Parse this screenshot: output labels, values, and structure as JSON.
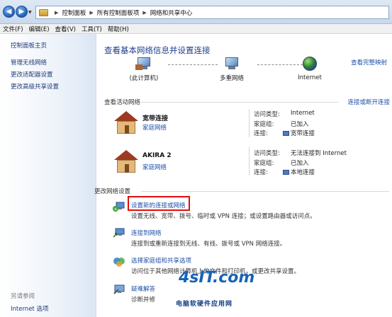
{
  "address_bar": {
    "breadcrumbs": [
      "控制面板",
      "所有控制面板项",
      "网络和共享中心"
    ]
  },
  "menu": [
    "文件(F)",
    "编辑(E)",
    "查看(V)",
    "工具(T)",
    "帮助(H)"
  ],
  "sidebar": {
    "items": [
      "控制面板主页",
      "管理无线网络",
      "更改适配器设置",
      "更改高级共享设置"
    ],
    "see_also": "另请参阅",
    "see_also_items": [
      "Internet 选项"
    ]
  },
  "main": {
    "title": "查看基本网络信息并设置连接",
    "full_map_link": "查看完整映射",
    "map": {
      "this_pc": "(此计算机)",
      "multiple_networks": "多重网络",
      "internet": "Internet"
    },
    "active_networks": {
      "heading": "查看活动网络",
      "connect_link": "连接或断开连接",
      "networks": [
        {
          "name": "宽带连接",
          "type": "家庭网络",
          "access_label": "访问类型:",
          "access": "Internet",
          "homegroup_label": "家庭组:",
          "homegroup": "已加入",
          "connections_label": "连接:",
          "connection": "宽带连接"
        },
        {
          "name": "AKIRA 2",
          "type": "家庭网络",
          "access_label": "访问类型:",
          "access": "无法连接到 Internet",
          "homegroup_label": "家庭组:",
          "homegroup": "已加入",
          "connections_label": "连接:",
          "connection": "本地连接"
        }
      ]
    },
    "change_settings": {
      "heading": "更改网络设置",
      "tasks": [
        {
          "title": "设置新的连接或网络",
          "desc": "设置无线、宽带、拨号、临时或 VPN 连接；或设置路由器或访问点。"
        },
        {
          "title": "连接到网络",
          "desc": "连接到或重新连接到无线、有线、拨号或 VPN 网络连接。"
        },
        {
          "title": "选择家庭组和共享选项",
          "desc": "访问位于其他网络计算机上的文件和打印机，或更改共享设置。"
        },
        {
          "title": "疑难解答",
          "desc": "诊断并修"
        }
      ]
    }
  },
  "watermark": {
    "logo": "4sIT.com",
    "text": "电脑软硬件应用网"
  }
}
